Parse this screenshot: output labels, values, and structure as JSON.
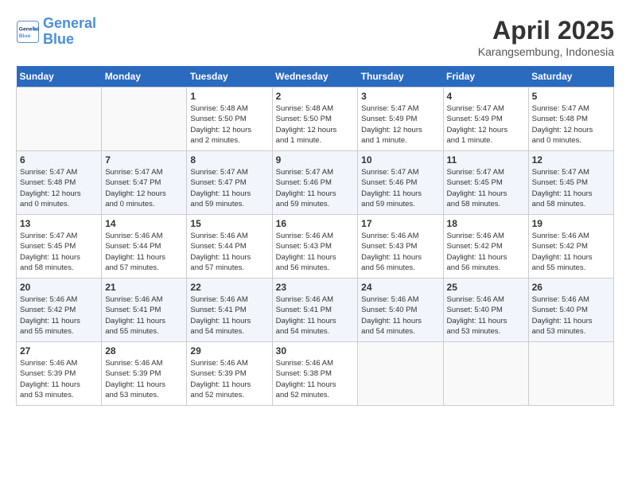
{
  "header": {
    "logo_line1": "General",
    "logo_line2": "Blue",
    "month": "April 2025",
    "location": "Karangsembung, Indonesia"
  },
  "weekdays": [
    "Sunday",
    "Monday",
    "Tuesday",
    "Wednesday",
    "Thursday",
    "Friday",
    "Saturday"
  ],
  "weeks": [
    [
      {
        "day": "",
        "info": ""
      },
      {
        "day": "",
        "info": ""
      },
      {
        "day": "1",
        "info": "Sunrise: 5:48 AM\nSunset: 5:50 PM\nDaylight: 12 hours\nand 2 minutes."
      },
      {
        "day": "2",
        "info": "Sunrise: 5:48 AM\nSunset: 5:50 PM\nDaylight: 12 hours\nand 1 minute."
      },
      {
        "day": "3",
        "info": "Sunrise: 5:47 AM\nSunset: 5:49 PM\nDaylight: 12 hours\nand 1 minute."
      },
      {
        "day": "4",
        "info": "Sunrise: 5:47 AM\nSunset: 5:49 PM\nDaylight: 12 hours\nand 1 minute."
      },
      {
        "day": "5",
        "info": "Sunrise: 5:47 AM\nSunset: 5:48 PM\nDaylight: 12 hours\nand 0 minutes."
      }
    ],
    [
      {
        "day": "6",
        "info": "Sunrise: 5:47 AM\nSunset: 5:48 PM\nDaylight: 12 hours\nand 0 minutes."
      },
      {
        "day": "7",
        "info": "Sunrise: 5:47 AM\nSunset: 5:47 PM\nDaylight: 12 hours\nand 0 minutes."
      },
      {
        "day": "8",
        "info": "Sunrise: 5:47 AM\nSunset: 5:47 PM\nDaylight: 11 hours\nand 59 minutes."
      },
      {
        "day": "9",
        "info": "Sunrise: 5:47 AM\nSunset: 5:46 PM\nDaylight: 11 hours\nand 59 minutes."
      },
      {
        "day": "10",
        "info": "Sunrise: 5:47 AM\nSunset: 5:46 PM\nDaylight: 11 hours\nand 59 minutes."
      },
      {
        "day": "11",
        "info": "Sunrise: 5:47 AM\nSunset: 5:45 PM\nDaylight: 11 hours\nand 58 minutes."
      },
      {
        "day": "12",
        "info": "Sunrise: 5:47 AM\nSunset: 5:45 PM\nDaylight: 11 hours\nand 58 minutes."
      }
    ],
    [
      {
        "day": "13",
        "info": "Sunrise: 5:47 AM\nSunset: 5:45 PM\nDaylight: 11 hours\nand 58 minutes."
      },
      {
        "day": "14",
        "info": "Sunrise: 5:46 AM\nSunset: 5:44 PM\nDaylight: 11 hours\nand 57 minutes."
      },
      {
        "day": "15",
        "info": "Sunrise: 5:46 AM\nSunset: 5:44 PM\nDaylight: 11 hours\nand 57 minutes."
      },
      {
        "day": "16",
        "info": "Sunrise: 5:46 AM\nSunset: 5:43 PM\nDaylight: 11 hours\nand 56 minutes."
      },
      {
        "day": "17",
        "info": "Sunrise: 5:46 AM\nSunset: 5:43 PM\nDaylight: 11 hours\nand 56 minutes."
      },
      {
        "day": "18",
        "info": "Sunrise: 5:46 AM\nSunset: 5:42 PM\nDaylight: 11 hours\nand 56 minutes."
      },
      {
        "day": "19",
        "info": "Sunrise: 5:46 AM\nSunset: 5:42 PM\nDaylight: 11 hours\nand 55 minutes."
      }
    ],
    [
      {
        "day": "20",
        "info": "Sunrise: 5:46 AM\nSunset: 5:42 PM\nDaylight: 11 hours\nand 55 minutes."
      },
      {
        "day": "21",
        "info": "Sunrise: 5:46 AM\nSunset: 5:41 PM\nDaylight: 11 hours\nand 55 minutes."
      },
      {
        "day": "22",
        "info": "Sunrise: 5:46 AM\nSunset: 5:41 PM\nDaylight: 11 hours\nand 54 minutes."
      },
      {
        "day": "23",
        "info": "Sunrise: 5:46 AM\nSunset: 5:41 PM\nDaylight: 11 hours\nand 54 minutes."
      },
      {
        "day": "24",
        "info": "Sunrise: 5:46 AM\nSunset: 5:40 PM\nDaylight: 11 hours\nand 54 minutes."
      },
      {
        "day": "25",
        "info": "Sunrise: 5:46 AM\nSunset: 5:40 PM\nDaylight: 11 hours\nand 53 minutes."
      },
      {
        "day": "26",
        "info": "Sunrise: 5:46 AM\nSunset: 5:40 PM\nDaylight: 11 hours\nand 53 minutes."
      }
    ],
    [
      {
        "day": "27",
        "info": "Sunrise: 5:46 AM\nSunset: 5:39 PM\nDaylight: 11 hours\nand 53 minutes."
      },
      {
        "day": "28",
        "info": "Sunrise: 5:46 AM\nSunset: 5:39 PM\nDaylight: 11 hours\nand 53 minutes."
      },
      {
        "day": "29",
        "info": "Sunrise: 5:46 AM\nSunset: 5:39 PM\nDaylight: 11 hours\nand 52 minutes."
      },
      {
        "day": "30",
        "info": "Sunrise: 5:46 AM\nSunset: 5:38 PM\nDaylight: 11 hours\nand 52 minutes."
      },
      {
        "day": "",
        "info": ""
      },
      {
        "day": "",
        "info": ""
      },
      {
        "day": "",
        "info": ""
      }
    ]
  ]
}
